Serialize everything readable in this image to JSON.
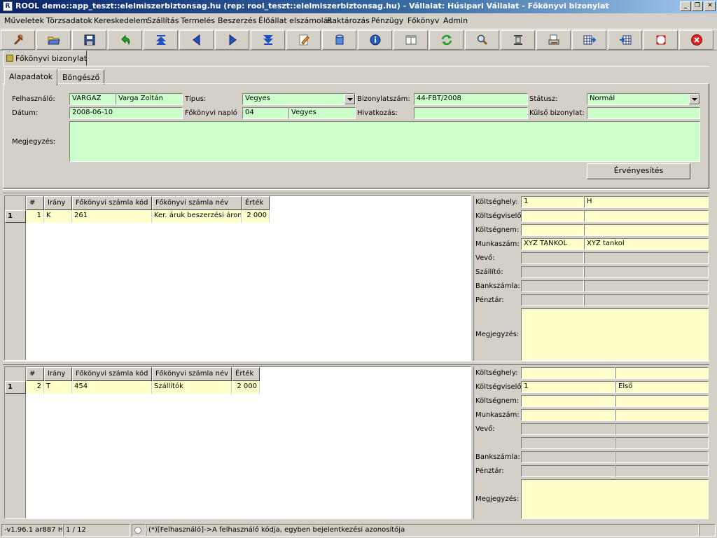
{
  "window": {
    "title": "ROOL demo::app_teszt::elelmiszerbiztonsag.hu (rep: rool_teszt::elelmiszerbiztonsag.hu) - Vállalat: Húsipari Vállalat - Főkönyvi bizonylat",
    "app_icon_letter": "R",
    "btn_min": "_",
    "btn_max": "❐",
    "btn_close": "✕"
  },
  "menu": [
    "Műveletek",
    "Törzsadatok",
    "Kereskedelem",
    "Szállítás",
    "Termelés",
    "Beszerzés",
    "Élőállat elszámolás",
    "Raktározás",
    "Pénzügy",
    "Főkönyv",
    "Admin"
  ],
  "toolbar": {
    "icons": [
      "tools-icon",
      "open-folder-icon",
      "save-disk-icon",
      "undo-arrow-icon",
      "first-record-icon",
      "previous-record-icon",
      "next-record-icon",
      "last-record-icon",
      "edit-pencil-icon",
      "database-icon",
      "info-icon",
      "form-view-icon",
      "refresh-icon",
      "search-icon",
      "row-height-icon",
      "print-preview-icon",
      "grid-add-icon",
      "grid-import-icon",
      "maximize-icon",
      "close-red-icon"
    ]
  },
  "doc_tab": {
    "label": "Főkönyvi bizonylat"
  },
  "tabs": {
    "alap": "Alapadatok",
    "bongeszo": "Böngésző"
  },
  "form": {
    "felhasznalo_label": "Felhasználó:",
    "felhasznalo_code": "VARGAZ",
    "felhasznalo_name": "Varga Zoltán",
    "tipus_label": "Típus:",
    "tipus_value": "Vegyes",
    "bizonylatszam_label": "Bizonylatszám:",
    "bizonylatszam_value": "44-FBT/2008",
    "statusz_label": "Státusz:",
    "statusz_value": "Normál",
    "datum_label": "Dátum:",
    "datum_value": "2008-06-10",
    "naplo_label": "Főkönyvi napló",
    "naplo_code": "04",
    "naplo_name": "Vegyes",
    "hivatkozas_label": "Hivatkozás:",
    "hivatkozas_value": "",
    "kulso_label": "Külső bizonylat:",
    "kulso_value": "",
    "megjegyzes_label": "Megjegyzés:",
    "megjegyzes_value": "",
    "ervenyesites_button": "Érvényesítés"
  },
  "grid1": {
    "columns": [
      "#",
      "Irány",
      "Főkönyvi számla kód",
      "Főkönyvi számla név",
      "Érték"
    ],
    "rows": [
      {
        "rowhdr": "1",
        "num": "1",
        "irany": "K",
        "kod": "261",
        "nev": "Ker. áruk beszerzési áron",
        "ertek": "2 000"
      }
    ]
  },
  "side1": {
    "koltseghely_label": "Költséghely:",
    "koltseghely_code": "1",
    "koltseghely_name": "H",
    "koltsegviselo_label": "Költségviselő:",
    "koltsegviselo_code": "",
    "koltsegviselo_name": "",
    "koltsegnem_label": "Költségnem:",
    "koltsegnem_code": "",
    "koltsegnem_name": "",
    "munkaszam_label": "Munkaszám:",
    "munkaszam_code": "XYZ TANKOL",
    "munkaszam_name": "XYZ tankol",
    "vevo_label": "Vevő:",
    "szallito_label": "Szállító:",
    "bankszamla_label": "Bankszámla:",
    "penztar_label": "Pénztár:",
    "megjegyzes_label": "Megjegyzés:"
  },
  "grid2": {
    "columns": [
      "#",
      "Irány",
      "Főkönyvi számla kód",
      "Főkönyvi számla név",
      "Érték"
    ],
    "rows": [
      {
        "rowhdr": "1",
        "num": "2",
        "irany": "T",
        "kod": "454",
        "nev": "Szállítók",
        "ertek": "2 000"
      }
    ]
  },
  "side2": {
    "koltseghely_label": "Költséghely:",
    "koltseghely_code": "",
    "koltseghely_name": "",
    "koltsegviselo_label": "Költségviselő:",
    "koltsegviselo_code": "1",
    "koltsegviselo_name": "Első",
    "koltsegnem_label": "Költségnem:",
    "munkaszam_label": "Munkaszám:",
    "vevo_label": "Vevő:",
    "bankszamla_label": "Bankszámla:",
    "penztar_label": "Pénztár:",
    "megjegyzes_label": "Megjegyzés:"
  },
  "status": {
    "version": "-v1.96.1 ar887 H",
    "record": "1 / 12",
    "hint": "(*)[Felhasználó]->A felhasználó kódja, egyben bejelentkezési azonosítója"
  }
}
